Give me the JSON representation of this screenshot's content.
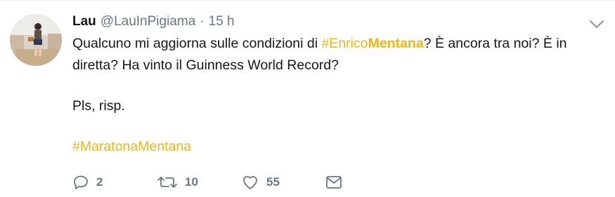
{
  "tweet": {
    "author_name": "Lau",
    "author_handle": "@LauInPigiama",
    "separator": "·",
    "timestamp": "15 h",
    "text_line1_before": "Qualcuno mi aggiorna sulle condizioni di ",
    "hashtag1_prefix": "#Enrico",
    "hashtag1_bold": "Mentana",
    "text_line1_after": "? È ancora tra noi? È in diretta? Ha vinto il Guinness World Record?",
    "text_line2": "Pls, risp.",
    "hashtag2": "#MaratonaMentana"
  },
  "actions": {
    "reply_count": "2",
    "retweet_count": "10",
    "like_count": "55"
  },
  "icons": {
    "reply": "reply-icon",
    "retweet": "retweet-icon",
    "like": "heart-icon",
    "message": "envelope-icon",
    "more": "chevron-down-icon"
  },
  "colors": {
    "hashtag": "#f0b417",
    "text": "#14171a",
    "muted": "#657786"
  }
}
